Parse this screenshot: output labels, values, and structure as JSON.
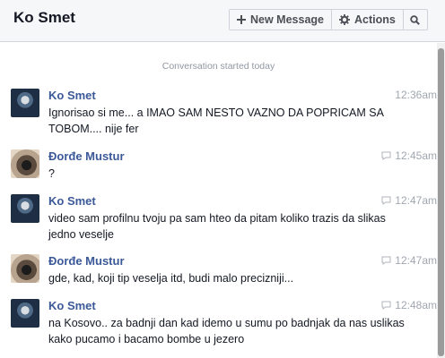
{
  "header": {
    "title": "Ko Smet",
    "new_message_label": "New Message",
    "actions_label": "Actions"
  },
  "conversation": {
    "started_label": "Conversation started today",
    "messages": [
      {
        "sender": "Ko Smet",
        "time": "12:36am",
        "text": "Ignorisao si me... a IMAO SAM NESTO VAZNO DA POPRICAM SA TOBOM.... nije fer",
        "avatar": "ko"
      },
      {
        "sender": "Đorđe Mustur",
        "time": "12:45am",
        "text": "?",
        "avatar": "dj"
      },
      {
        "sender": "Ko Smet",
        "time": "12:47am",
        "text": "video sam profilnu tvoju pa sam hteo da pitam koliko trazis da slikas jedno veselje",
        "avatar": "ko"
      },
      {
        "sender": "Đorđe Mustur",
        "time": "12:47am",
        "text": "gde, kad, koji tip veselja itd, budi malo precizniji...",
        "avatar": "dj"
      },
      {
        "sender": "Ko Smet",
        "time": "12:48am",
        "text": "na Kosovo.. za badnji dan kad idemo u sumu po badnjak da nas uslikas kako pucamo i bacamo bombe u jezero",
        "avatar": "ko"
      }
    ]
  },
  "icons": {
    "new_message": "plus-icon",
    "actions": "gear-icon",
    "search": "search-icon",
    "sent_status": "reply-icon"
  },
  "colors": {
    "name_link": "#3b5998",
    "header_bg": "#f6f7f9",
    "muted_text": "#9197a3"
  }
}
